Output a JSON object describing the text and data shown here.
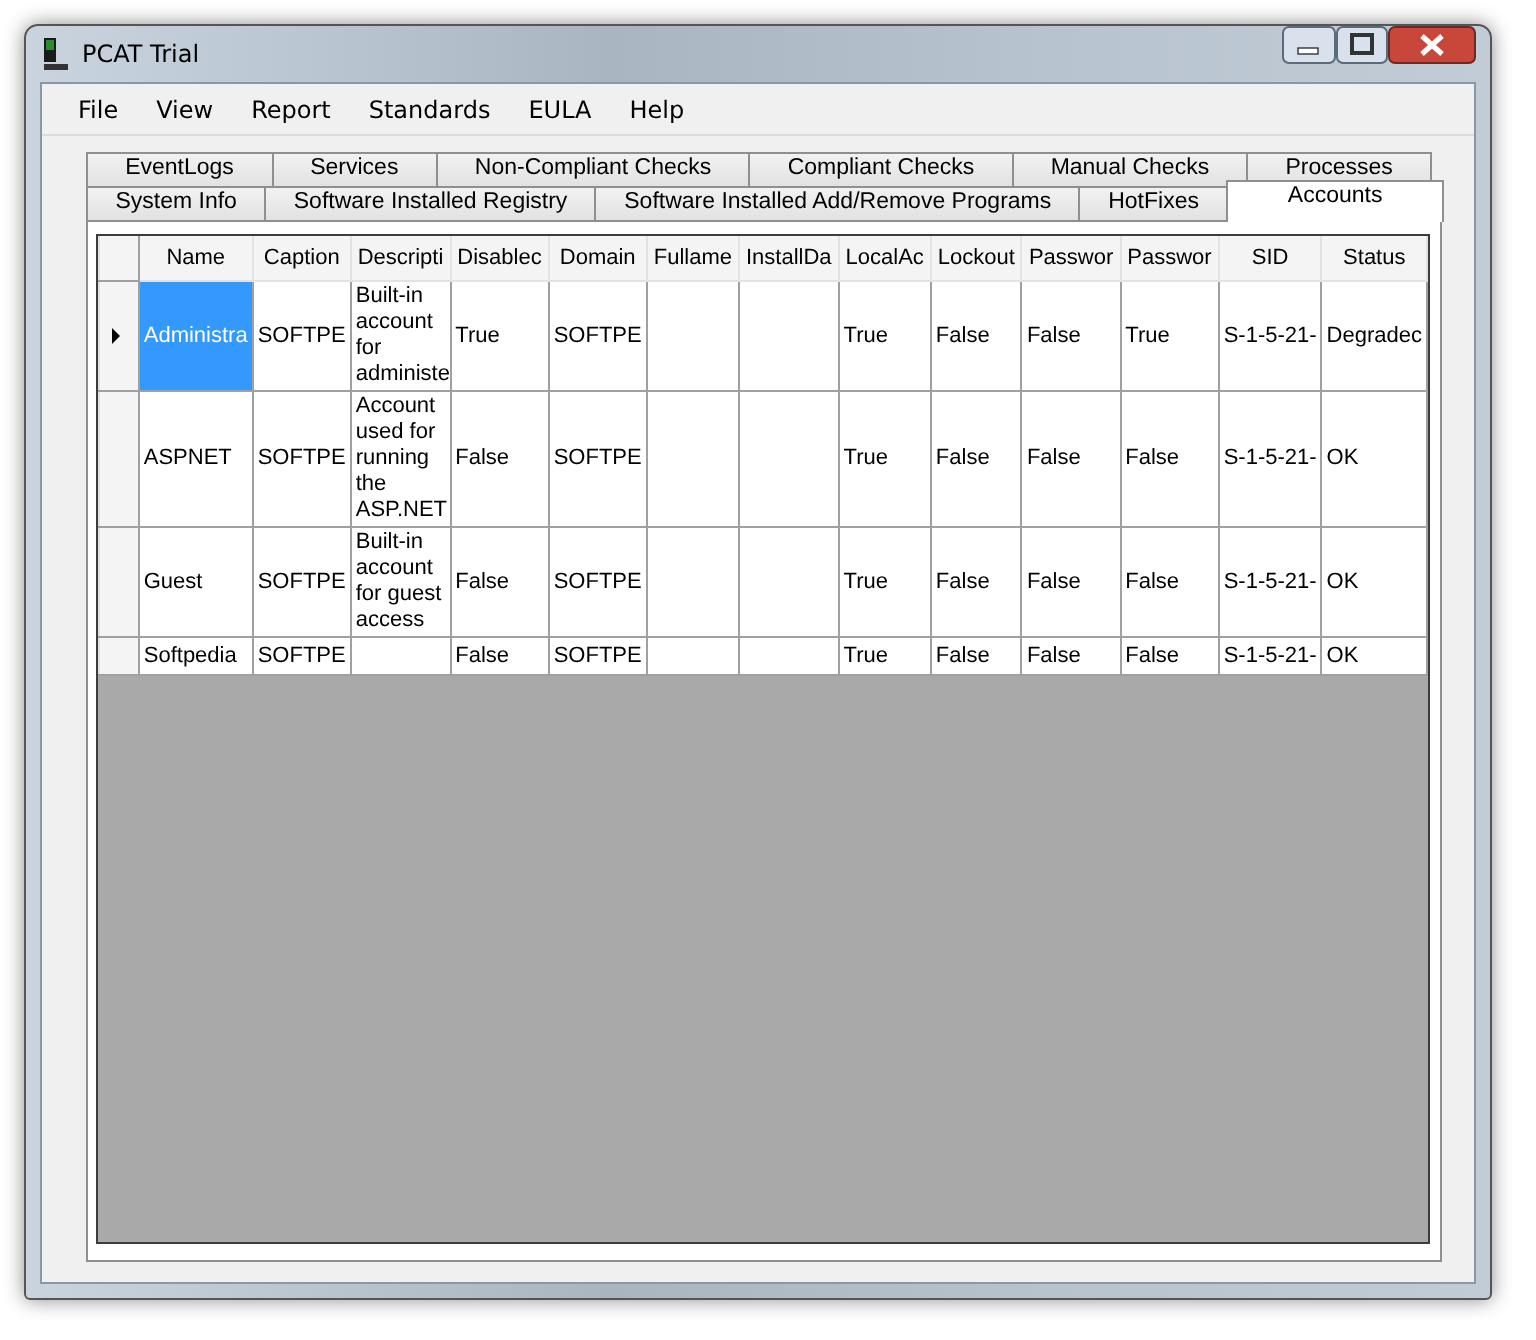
{
  "window": {
    "title": "PCAT Trial"
  },
  "menu": [
    "File",
    "View",
    "Report",
    "Standards",
    "EULA",
    "Help"
  ],
  "tab_rows": [
    [
      {
        "label": "EventLogs",
        "selected": false
      },
      {
        "label": "Services",
        "selected": false
      },
      {
        "label": "Non-Compliant Checks",
        "selected": false
      },
      {
        "label": "Compliant Checks",
        "selected": false
      },
      {
        "label": "Manual Checks",
        "selected": false
      },
      {
        "label": "Processes",
        "selected": false
      }
    ],
    [
      {
        "label": "System Info",
        "selected": false
      },
      {
        "label": "Software Installed Registry",
        "selected": false
      },
      {
        "label": "Software Installed Add/Remove Programs",
        "selected": false
      },
      {
        "label": "HotFixes",
        "selected": false
      },
      {
        "label": "Accounts",
        "selected": true
      }
    ]
  ],
  "grid": {
    "columns": [
      "Name",
      "Caption",
      "Descripti",
      "Disablec",
      "Domain",
      "Fullame",
      "InstallDa",
      "LocalAc",
      "Lockout",
      "Passwor",
      "Passwor",
      "SID",
      "Status"
    ],
    "rows": [
      {
        "selected": true,
        "cells": [
          "Administra",
          "SOFTPE",
          "Built-in account for administe",
          "True",
          "SOFTPE",
          "",
          "",
          "True",
          "False",
          "False",
          "True",
          "S-1-5-21-",
          "Degradec"
        ]
      },
      {
        "selected": false,
        "cells": [
          "ASPNET",
          "SOFTPE",
          "Account used for running the ASP.NET",
          "False",
          "SOFTPE",
          "",
          "",
          "True",
          "False",
          "False",
          "False",
          "S-1-5-21-",
          "OK"
        ]
      },
      {
        "selected": false,
        "cells": [
          "Guest",
          "SOFTPE",
          "Built-in account for guest access",
          "False",
          "SOFTPE",
          "",
          "",
          "True",
          "False",
          "False",
          "False",
          "S-1-5-21-",
          "OK"
        ]
      },
      {
        "selected": false,
        "cells": [
          "Softpedia",
          "SOFTPE",
          "",
          "False",
          "SOFTPE",
          "",
          "",
          "True",
          "False",
          "False",
          "False",
          "S-1-5-21-",
          "OK"
        ]
      }
    ]
  }
}
